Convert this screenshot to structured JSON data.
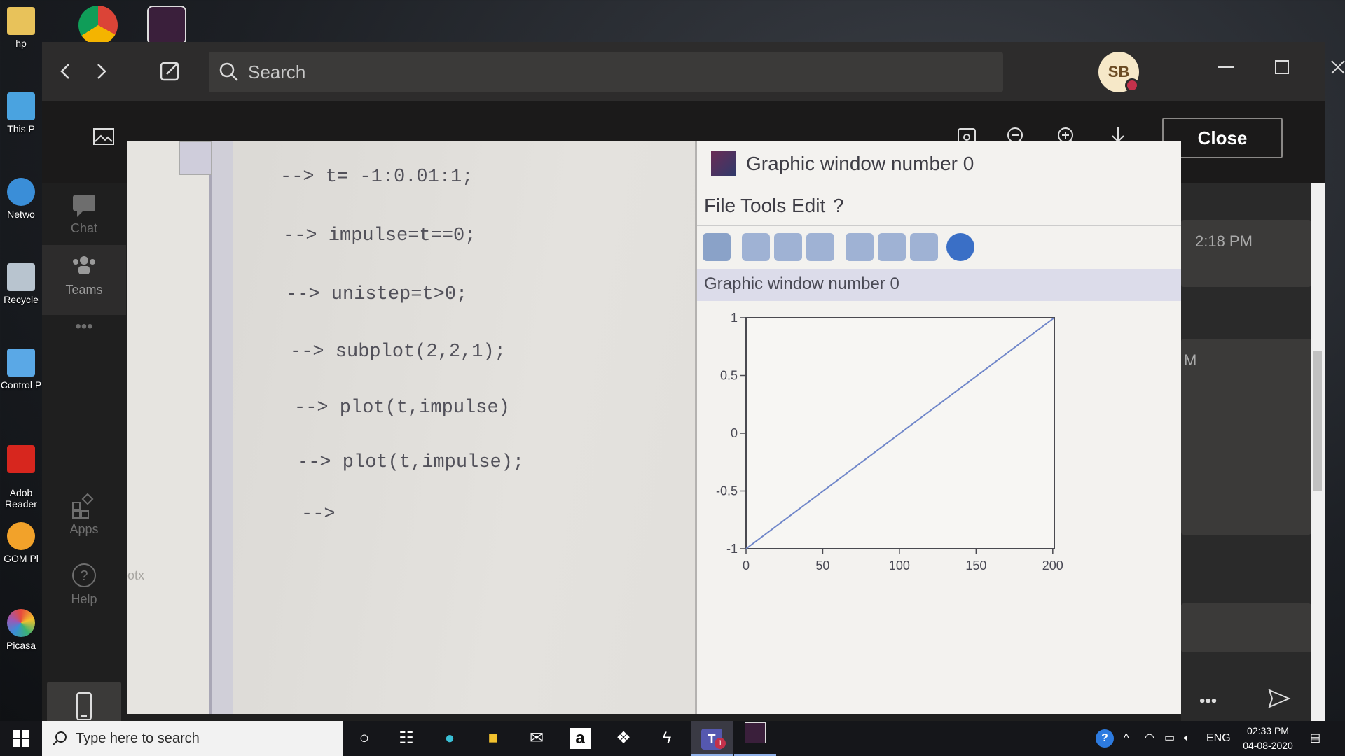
{
  "desktop": {
    "icons": [
      "hp",
      "This P",
      "Netwo",
      "Recycle",
      "Control P",
      "Adob\nReader",
      "GOM Pl",
      "Picasa"
    ]
  },
  "titlebar": {
    "search_placeholder": "Search",
    "avatar_initials": "SB"
  },
  "viewer": {
    "close_label": "Close"
  },
  "rail": {
    "items": [
      {
        "label": "Chat"
      },
      {
        "label": "Teams"
      },
      {
        "label": "•••"
      },
      {
        "label": "Apps"
      },
      {
        "label": "Help"
      }
    ]
  },
  "chat": {
    "time1": "2:18 PM",
    "time2": "M",
    "more": "•••"
  },
  "photo": {
    "console_lines": [
      "--> t= -1:0.01:1;",
      "--> impulse=t==0;",
      "--> unistep=t>0;",
      "--> subplot(2,2,1);",
      "--> plot(t,impulse)",
      "--> plot(t,impulse);",
      "-->"
    ],
    "side_text": "otx",
    "graphic_window": {
      "title": "Graphic window number 0",
      "menu": [
        "File",
        "Tools",
        "Edit",
        "?"
      ],
      "caption": "Graphic window number 0"
    }
  },
  "chart_data": {
    "type": "line",
    "x": [
      0,
      201
    ],
    "y": [
      -1,
      1
    ],
    "xticks": [
      "0",
      "50",
      "100",
      "150",
      "200"
    ],
    "yticks": [
      "1",
      "0.5",
      "0",
      "-0.5",
      "-1"
    ],
    "xlim": [
      0,
      201
    ],
    "ylim": [
      -1,
      1
    ],
    "color": "#6f86c9"
  },
  "taskbar": {
    "search_placeholder": "Type here to search",
    "lang": "ENG",
    "time": "02:33 PM",
    "date": "04-08-2020",
    "teams_badge": "1"
  }
}
